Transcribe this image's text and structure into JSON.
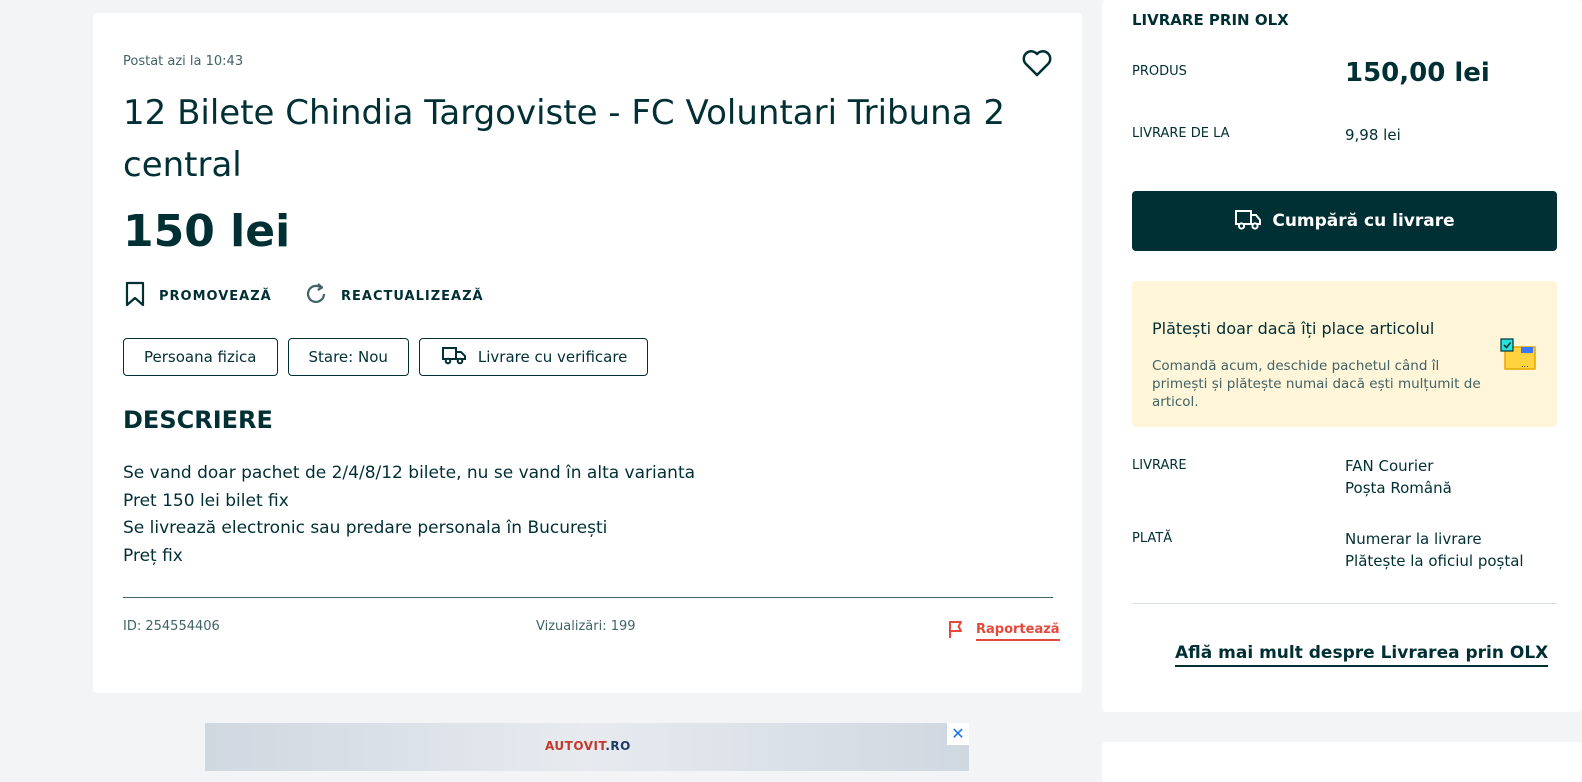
{
  "listing": {
    "posted": "Postat azi la 10:43",
    "title": "12 Bilete Chindia Targoviste - FC Voluntari Tribuna 2 central",
    "price": "150 lei",
    "actions": {
      "promote": "PROMOVEAZĂ",
      "refresh": "REACTUALIZEAZĂ"
    },
    "chips": [
      "Persoana fizica",
      "Stare: Nou",
      "Livrare cu verificare"
    ],
    "description_heading": "DESCRIERE",
    "description_lines": [
      "Se vand doar pachet de 2/4/8/12 bilete, nu se vand în alta varianta",
      "Pret 150 lei bilet fix",
      "Se livrează electronic sau predare personala în București",
      "Preț fix"
    ],
    "id": "ID: 254554406",
    "views": "Vizualizări: 199",
    "report": "Raportează"
  },
  "ad": {
    "logo_a": "AUTOVIT",
    "logo_b": ".RO",
    "close": "✕"
  },
  "delivery": {
    "title": "LIVRARE PRIN OLX",
    "product_label": "PRODUS",
    "product_price": "150,00 lei",
    "delivery_from_label": "LIVRARE DE LA",
    "delivery_from_price": "9,98 lei",
    "buy_button": "Cumpără cu livrare",
    "info_heading": "Plătești doar dacă îți place articolul",
    "info_text": "Comandă acum, deschide pachetul când îl primești și plătește numai dacă ești mulțumit de articol.",
    "courier_label": "LIVRARE",
    "couriers": [
      "FAN Courier",
      "Poșta Română"
    ],
    "payment_label": "PLATĂ",
    "payments": [
      "Numerar la livrare",
      "Plătește la oficiul poștal"
    ],
    "learn_more": "Află mai mult despre Livrarea prin OLX"
  },
  "colors": {
    "primary": "#002f34",
    "secondary_text": "#406367",
    "report": "#e4493b",
    "info_bg": "#fff5d9",
    "page_bg": "#f2f4f5"
  },
  "icons": [
    "heart-icon",
    "bookmark-icon",
    "refresh-icon",
    "truck-icon",
    "flag-icon",
    "delivery-illustration-icon"
  ]
}
